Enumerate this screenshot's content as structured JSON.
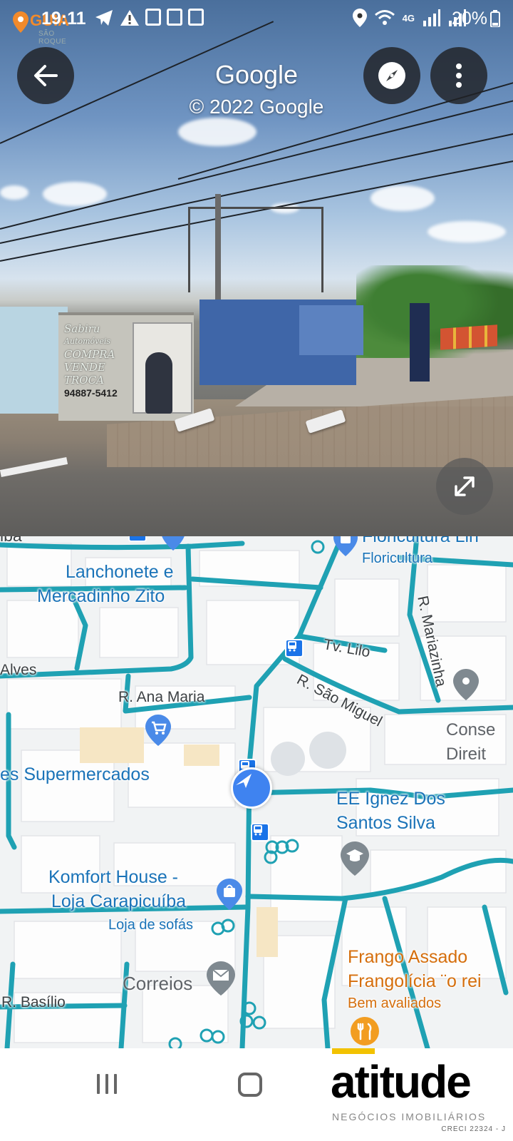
{
  "status_bar": {
    "time": "19:11",
    "battery": "20%",
    "network": "4G",
    "overlay_logo": {
      "name": "GUIA",
      "subtitle": "SÃO ROQUE"
    }
  },
  "street_view": {
    "title": "Google",
    "copyright": "© 2022 Google",
    "buttons": {
      "back": "arrow-back-icon",
      "compass": "compass-icon",
      "more": "more-vert-icon",
      "expand": "expand-icon"
    },
    "storefront_sign": [
      "Sabiru",
      "Automóveis",
      "COMPRA",
      "VENDE",
      "TROCA",
      "94887-5412"
    ]
  },
  "map": {
    "places": [
      {
        "name": "Floricultura Lin",
        "category": "Floricultura",
        "color": "#1a73b8"
      },
      {
        "name": "Lanchonete e",
        "name2": "Mercadinho Zito"
      },
      {
        "name": "es Supermercados"
      },
      {
        "name": "EE Ignez Dos",
        "name2": "Santos Silva"
      },
      {
        "name": "Komfort House -",
        "name2": "Loja Carapicuíba",
        "category": "Loja de sofás"
      },
      {
        "name": "Correios"
      },
      {
        "name": "Frango Assado",
        "name2": "Frangolícia ¨o rei",
        "category": "Bem avaliados",
        "color": "#d56e0c"
      },
      {
        "name": "Conse",
        "name2": "Direit"
      }
    ],
    "streets": [
      "iba",
      "Alves",
      "R. Ana Maria",
      "R. São Miguel",
      "Tv. Lilo",
      "R. Mariazinha",
      "R. Basílio"
    ],
    "colors": {
      "route": "#1fa1b3",
      "background": "#f1f3f4",
      "blocks": "#ffffff",
      "accent": "#1a73e8"
    }
  },
  "nav_bar": {
    "recents": "recents-icon",
    "home": "home-icon",
    "watermark": {
      "brand": "atitude",
      "tagline": "NEGÓCIOS IMOBILIÁRIOS",
      "creci": "CRECI 22324 - J"
    }
  }
}
